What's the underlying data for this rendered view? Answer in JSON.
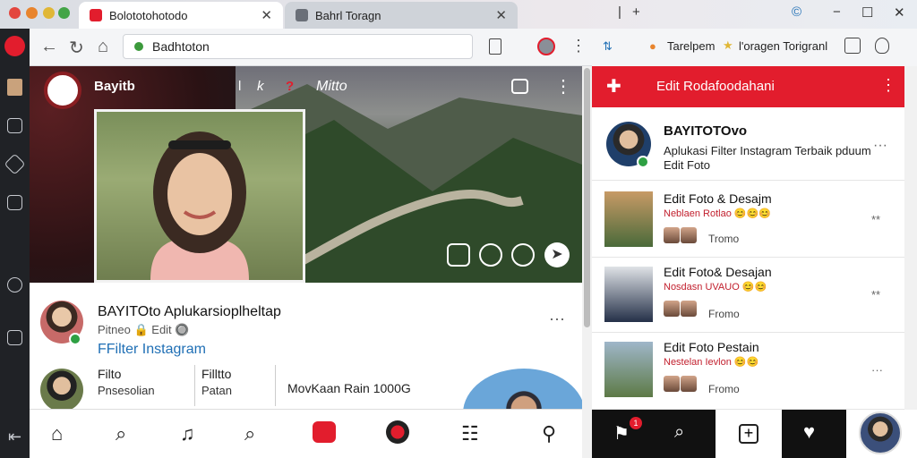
{
  "browser": {
    "tabs": [
      {
        "label": "Bolototohotodo",
        "active": true
      },
      {
        "label": "Bahrl Toragn",
        "active": false
      }
    ],
    "new_tab": "+",
    "address": "Badhtoton"
  },
  "instagram": {
    "header": {
      "name": "Bayitb",
      "center_a": "l",
      "center_b": "k",
      "center_c": "?",
      "title": "Mitto"
    },
    "post": {
      "title": "BAYITOto Aplukarsioplheltap",
      "line2": "Pitneo 🔒 Edit 🔘",
      "link": "FFilter Instagram",
      "col1_a": "Filto",
      "col1_b": "Pnsesolian",
      "col2_a": "Filltto",
      "col2_b": "Patan",
      "col3": "MovKaan Rain 1000G"
    }
  },
  "right_panel": {
    "bookmarks": {
      "item1": "Tarelpem",
      "item2": "l'oragen Torigranl"
    },
    "header": "Edit Rodafoodahani",
    "profile": {
      "name": "BAYITOTOvo",
      "desc": "Aplukasi Filter Instagram Terbaik pduum",
      "sub": "Edit Foto"
    },
    "cards": [
      {
        "title": "Edit Foto & Desajm",
        "subtitle": "Neblaen Rotlao 😊😊😊",
        "meta": "Tromo",
        "count": "**"
      },
      {
        "title": "Edit Foto& Desajan",
        "subtitle": "Nosdasn UVAUO 😊😊",
        "meta": "Fromo",
        "count": "**"
      },
      {
        "title": "Edit Foto Pestain",
        "subtitle": "Nestelan Ievlon 😊😊",
        "meta": "Fromo",
        "count": "···"
      }
    ],
    "badge": "1"
  },
  "colors": {
    "accent": "#e21d2d",
    "link": "#1f6fb5",
    "rail": "#202226"
  }
}
